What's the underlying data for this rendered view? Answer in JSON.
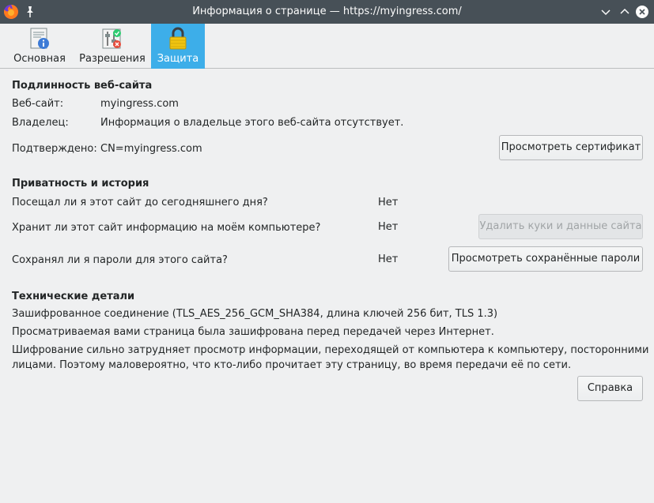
{
  "window": {
    "title": "Информация о странице — https://myingress.com/",
    "icons": [
      "firefox-icon",
      "pin-icon",
      "minimize-icon",
      "maximize-icon",
      "close-icon"
    ]
  },
  "tabs": [
    {
      "label": "Основная",
      "icon": "info-document-icon"
    },
    {
      "label": "Разрешения",
      "icon": "permissions-icon"
    },
    {
      "label": "Защита",
      "icon": "padlock-icon",
      "selected": true
    }
  ],
  "identity": {
    "heading": "Подлинность веб-сайта",
    "website_label": "Веб-сайт:",
    "website_value": "myingress.com",
    "owner_label": "Владелец:",
    "owner_value": "Информация о владельце этого веб-сайта отсутствует.",
    "verified_label": "Подтверждено:",
    "verified_value": "CN=myingress.com",
    "view_certificate_button": "Просмотреть сертификат"
  },
  "privacy": {
    "heading": "Приватность и история",
    "visited_question": "Посещал ли я этот сайт до сегодняшнего дня?",
    "visited_answer": "Нет",
    "storage_question": "Хранит ли этот сайт информацию на моём компьютере?",
    "storage_answer": "Нет",
    "clear_cookies_button": "Удалить куки и данные сайта",
    "passwords_question": "Сохранял ли я пароли для этого сайта?",
    "passwords_answer": "Нет",
    "view_passwords_button": "Просмотреть сохранённые пароли"
  },
  "technical": {
    "heading": "Технические детали",
    "connection": "Зашифрованное соединение (TLS_AES_256_GCM_SHA384, длина ключей 256 бит, TLS 1.3)",
    "encrypted_note": "Просматриваемая вами страница была зашифрована перед передачей через Интернет.",
    "explanation_line1": "Шифрование сильно затрудняет просмотр информации, переходящей от компьютера к компьютеру, посторонними",
    "explanation_line2": "лицами. Поэтому маловероятно, что кто-либо прочитает эту страницу, во время передачи её по сети."
  },
  "help_button": "Справка",
  "colors": {
    "titlebar": "#475057",
    "selected_tab": "#3daee9",
    "background": "#eff0f1"
  }
}
